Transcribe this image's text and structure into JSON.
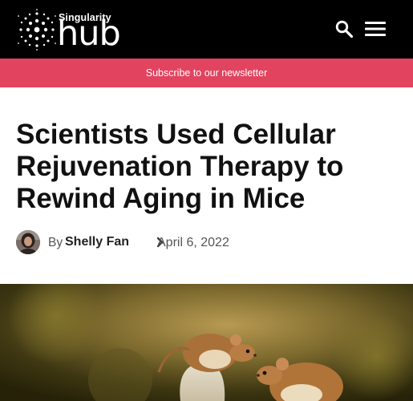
{
  "header": {
    "logo": {
      "top_text": "Singularity",
      "bottom_text": "hub"
    },
    "search_icon": "search-icon",
    "menu_icon": "menu-icon",
    "background": "#000000"
  },
  "newsletter": {
    "label": "Subscribe to our newsletter",
    "background": "#e2435f"
  },
  "article": {
    "title": "Scientists Used Cellular Rejuvenation Therapy to Rewind Aging in Mice",
    "byline": {
      "by": "By",
      "author": "Shelly Fan",
      "date": "April 6, 2022",
      "separator_icon": "chevron-right-icon"
    }
  },
  "hero_image": {
    "subject": "two harvest mice on a seed pod"
  }
}
